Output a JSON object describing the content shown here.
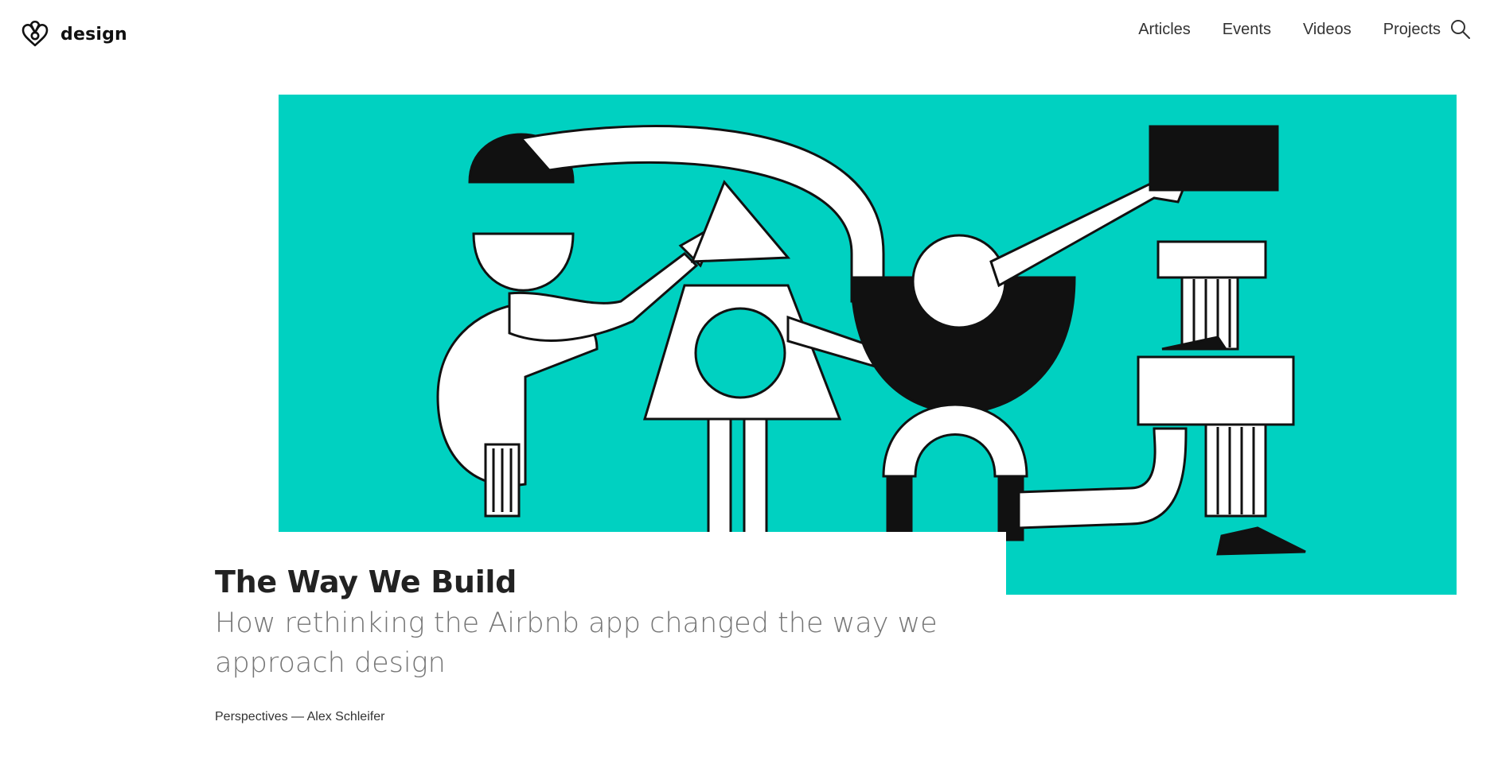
{
  "header": {
    "logo_text": "design",
    "logo_icon": "airbnb-belo-icon",
    "nav": [
      {
        "label": "Articles"
      },
      {
        "label": "Events"
      },
      {
        "label": "Videos"
      },
      {
        "label": "Projects"
      }
    ],
    "search_icon": "search-icon"
  },
  "hero": {
    "background_color": "#00d1c1"
  },
  "article": {
    "title": "The Way We Build",
    "subtitle": "How rethinking the Airbnb app changed the way we approach design",
    "category": "Perspectives",
    "separator": " — ",
    "author": "Alex Schleifer"
  }
}
